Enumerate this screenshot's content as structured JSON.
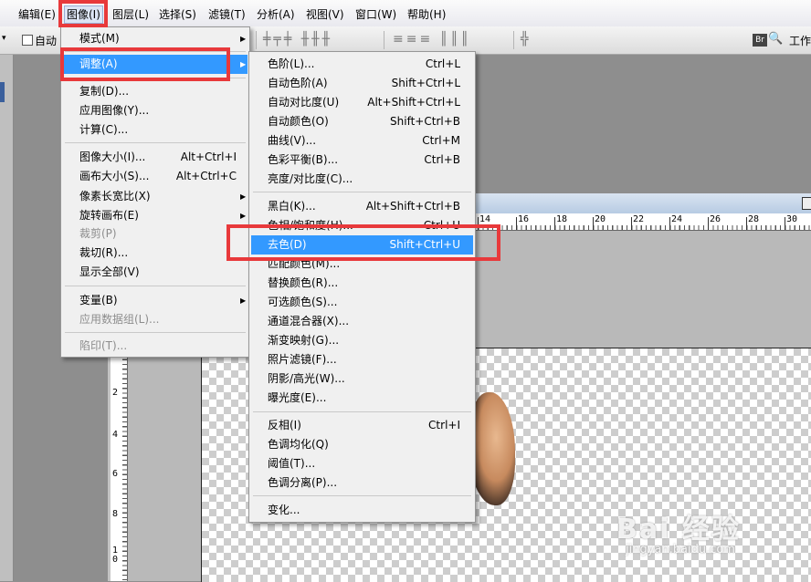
{
  "menubar": {
    "items": [
      {
        "label": "编辑(E)"
      },
      {
        "label": "图像(I)"
      },
      {
        "label": "图层(L)"
      },
      {
        "label": "选择(S)"
      },
      {
        "label": "滤镜(T)"
      },
      {
        "label": "分析(A)"
      },
      {
        "label": "视图(V)"
      },
      {
        "label": "窗口(W)"
      },
      {
        "label": "帮助(H)"
      }
    ]
  },
  "toolbar": {
    "auto_select_label": "自动",
    "workspace_label": "工作",
    "bridge_label": "Br"
  },
  "ruler": {
    "h_numbers": [
      "14",
      "16",
      "18",
      "20",
      "22",
      "24",
      "26",
      "28",
      "30"
    ],
    "v_numbers": [
      "2",
      "4",
      "6",
      "8",
      "1",
      "0"
    ]
  },
  "image_menu": {
    "items": [
      {
        "label": "模式(M)",
        "shortcut": "",
        "submenu": true,
        "disabled": false
      },
      {
        "label": "调整(A)",
        "shortcut": "",
        "submenu": true,
        "disabled": false,
        "highlighted": true
      },
      {
        "label": "复制(D)...",
        "shortcut": "",
        "submenu": false,
        "disabled": false
      },
      {
        "label": "应用图像(Y)...",
        "shortcut": "",
        "submenu": false,
        "disabled": false
      },
      {
        "label": "计算(C)...",
        "shortcut": "",
        "submenu": false,
        "disabled": false
      },
      {
        "label": "图像大小(I)...",
        "shortcut": "Alt+Ctrl+I",
        "submenu": false,
        "disabled": false
      },
      {
        "label": "画布大小(S)...",
        "shortcut": "Alt+Ctrl+C",
        "submenu": false,
        "disabled": false
      },
      {
        "label": "像素长宽比(X)",
        "shortcut": "",
        "submenu": true,
        "disabled": false
      },
      {
        "label": "旋转画布(E)",
        "shortcut": "",
        "submenu": true,
        "disabled": false
      },
      {
        "label": "裁剪(P)",
        "shortcut": "",
        "submenu": false,
        "disabled": true
      },
      {
        "label": "裁切(R)...",
        "shortcut": "",
        "submenu": false,
        "disabled": false
      },
      {
        "label": "显示全部(V)",
        "shortcut": "",
        "submenu": false,
        "disabled": false
      },
      {
        "label": "变量(B)",
        "shortcut": "",
        "submenu": true,
        "disabled": false
      },
      {
        "label": "应用数据组(L)...",
        "shortcut": "",
        "submenu": false,
        "disabled": true
      },
      {
        "label": "陷印(T)...",
        "shortcut": "",
        "submenu": false,
        "disabled": true
      }
    ]
  },
  "adjust_menu": {
    "items": [
      {
        "label": "色阶(L)...",
        "shortcut": "Ctrl+L"
      },
      {
        "label": "自动色阶(A)",
        "shortcut": "Shift+Ctrl+L"
      },
      {
        "label": "自动对比度(U)",
        "shortcut": "Alt+Shift+Ctrl+L"
      },
      {
        "label": "自动颜色(O)",
        "shortcut": "Shift+Ctrl+B"
      },
      {
        "label": "曲线(V)...",
        "shortcut": "Ctrl+M"
      },
      {
        "label": "色彩平衡(B)...",
        "shortcut": "Ctrl+B"
      },
      {
        "label": "亮度/对比度(C)...",
        "shortcut": ""
      },
      {
        "label": "黑白(K)...",
        "shortcut": "Alt+Shift+Ctrl+B"
      },
      {
        "label": "色相/饱和度(H)...",
        "shortcut": "Ctrl+U"
      },
      {
        "label": "去色(D)",
        "shortcut": "Shift+Ctrl+U",
        "highlighted": true
      },
      {
        "label": "匹配颜色(M)...",
        "shortcut": ""
      },
      {
        "label": "替换颜色(R)...",
        "shortcut": ""
      },
      {
        "label": "可选颜色(S)...",
        "shortcut": ""
      },
      {
        "label": "通道混合器(X)...",
        "shortcut": ""
      },
      {
        "label": "渐变映射(G)...",
        "shortcut": ""
      },
      {
        "label": "照片滤镜(F)...",
        "shortcut": ""
      },
      {
        "label": "阴影/高光(W)...",
        "shortcut": ""
      },
      {
        "label": "曝光度(E)...",
        "shortcut": ""
      },
      {
        "label": "反相(I)",
        "shortcut": "Ctrl+I"
      },
      {
        "label": "色调均化(Q)",
        "shortcut": ""
      },
      {
        "label": "阈值(T)...",
        "shortcut": ""
      },
      {
        "label": "色调分离(P)...",
        "shortcut": ""
      },
      {
        "label": "变化...",
        "shortcut": ""
      }
    ]
  },
  "watermark": {
    "text": "Bai 经验",
    "sub": "jingyan.baidu.com"
  },
  "colors": {
    "highlight": "#3399ff",
    "annotation_red": "#e8393b"
  },
  "icons": [
    "submenu-arrow-icon",
    "checkbox-icon",
    "bridge-icon",
    "zoom-icon",
    "align-icons"
  ]
}
